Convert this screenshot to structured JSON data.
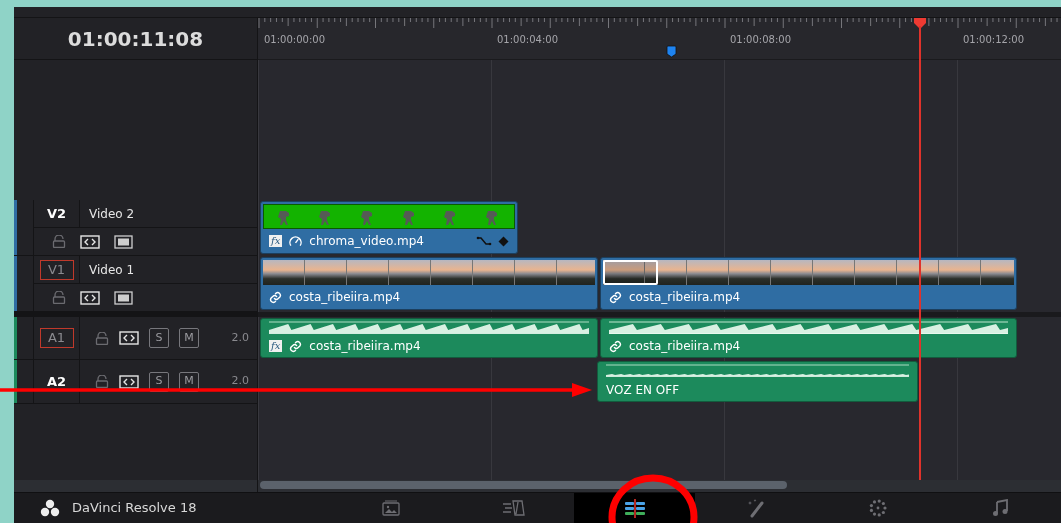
{
  "timecode": "01:00:11:08",
  "ruler": {
    "labels": [
      "01:00:00:00",
      "01:00:04:00",
      "01:00:08:00",
      "01:00:12:00"
    ]
  },
  "tracks": [
    {
      "kind": "video",
      "label": "V2",
      "name": "Video 2",
      "destination": false,
      "clips": [
        {
          "kind": "greenscreen",
          "name": "chroma_video.mp4",
          "badge": "fx",
          "linked": false,
          "speed": true,
          "keyframes": true,
          "trim_selected": false
        }
      ]
    },
    {
      "kind": "video",
      "label": "V1",
      "name": "Video 1",
      "destination": true,
      "clips": [
        {
          "kind": "landscape",
          "name": "costa_ribeiira.mp4",
          "linked": true,
          "speed": false,
          "keyframes": false,
          "trim_selected": false
        },
        {
          "kind": "landscape",
          "name": "costa_ribeiira.mp4",
          "linked": true,
          "speed": false,
          "keyframes": false,
          "trim_selected": true
        }
      ]
    },
    {
      "kind": "audio",
      "label": "A1",
      "destination": true,
      "buttons": [
        "S",
        "M"
      ],
      "volume": "2.0",
      "clips": [
        {
          "kind": "audio",
          "name": "costa_ribeiira.mp4",
          "badge": "fx",
          "linked": true,
          "loud": true
        },
        {
          "kind": "audio",
          "name": "costa_ribeiira.mp4",
          "linked": true,
          "loud": true
        }
      ]
    },
    {
      "kind": "audio",
      "label": "A2",
      "destination": false,
      "buttons": [
        "S",
        "M"
      ],
      "volume": "2.0",
      "clips": [
        {
          "kind": "audio",
          "name": "VOZ EN OFF",
          "linked": false,
          "loud": false
        }
      ]
    }
  ],
  "app": {
    "name": "DaVinci Resolve 18"
  },
  "pages": [
    {
      "kind": "media",
      "selected": false
    },
    {
      "kind": "cut",
      "selected": false
    },
    {
      "kind": "edit",
      "selected": true
    },
    {
      "kind": "fusion",
      "selected": false
    },
    {
      "kind": "color",
      "selected": false
    },
    {
      "kind": "fairlight",
      "selected": false
    }
  ]
}
